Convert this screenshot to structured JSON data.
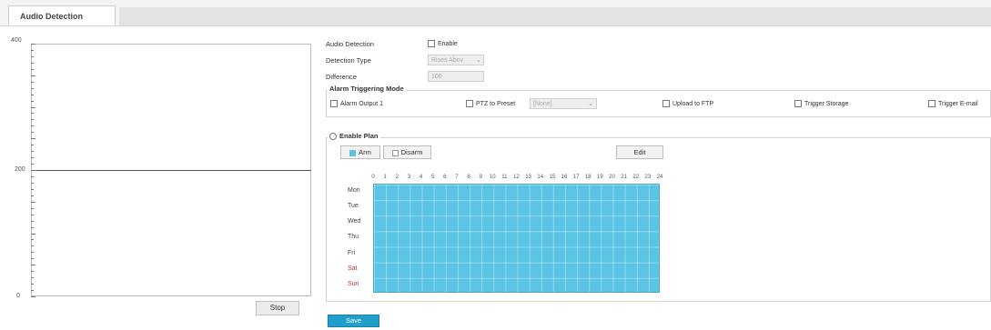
{
  "tabs": [
    {
      "label": "Audio Detection"
    }
  ],
  "graph": {
    "y_max": "400",
    "y_mid": "200",
    "y_min": "0",
    "stop_label": "Stop"
  },
  "form": {
    "audio_detection_label": "Audio Detection",
    "enable_label": "Enable",
    "enable_checked": false,
    "detection_type_label": "Detection Type",
    "detection_type_value": "Rises Abov",
    "difference_label": "Difference",
    "difference_value": "100"
  },
  "alarm": {
    "legend": "Alarm Triggering Mode",
    "alarm_output": "Alarm Output 1",
    "ptz_preset": "PTZ to Preset",
    "ptz_value": "[None]",
    "upload_ftp": "Upload to FTP",
    "trigger_storage": "Trigger Storage",
    "trigger_email": "Trigger E-mail"
  },
  "plan": {
    "legend": "Enable Plan",
    "arm_label": "Arm",
    "disarm_label": "Disarm",
    "edit_label": "Edit",
    "hours": [
      "0",
      "1",
      "2",
      "3",
      "4",
      "5",
      "6",
      "7",
      "8",
      "9",
      "10",
      "11",
      "12",
      "13",
      "14",
      "15",
      "16",
      "17",
      "18",
      "19",
      "20",
      "21",
      "22",
      "23",
      "24"
    ],
    "days": [
      "Mon",
      "Tue",
      "Wed",
      "Thu",
      "Fri",
      "Sat",
      "Sun"
    ],
    "arm_color": "#5bc4e4",
    "weekend_color": "#c0392b"
  },
  "footer": {
    "save_label": "Save"
  }
}
